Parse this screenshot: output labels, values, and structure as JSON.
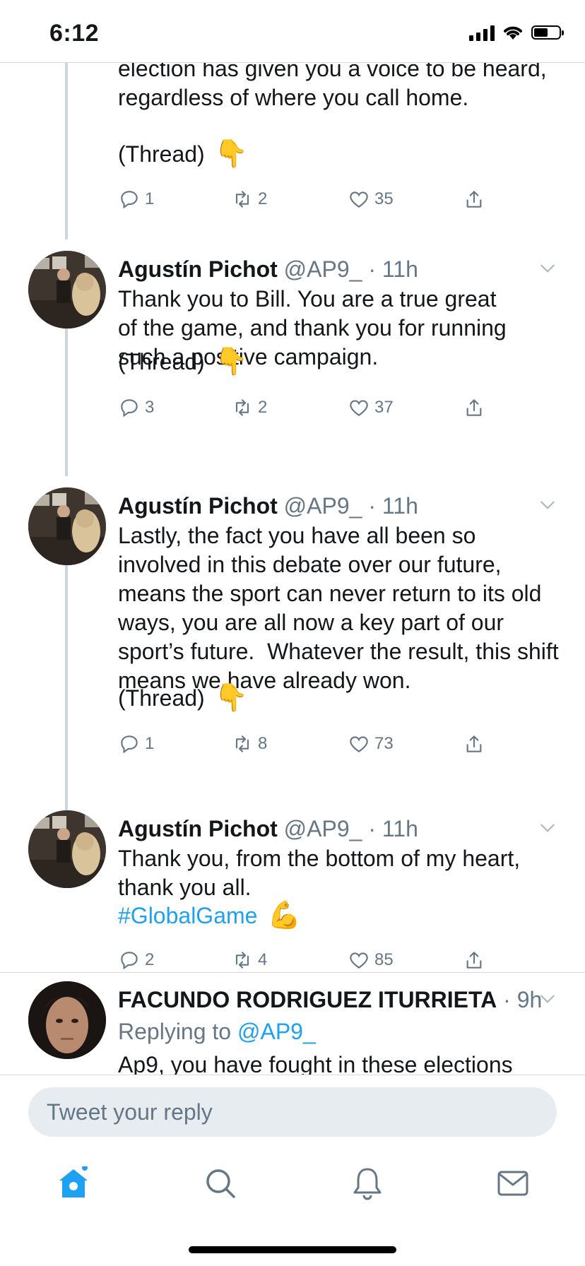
{
  "status_bar": {
    "time": "6:12",
    "battery_level": 0.55
  },
  "colors": {
    "accent": "#1da1f2",
    "secondary_text": "#657786",
    "thread_line": "#ccd6dd",
    "divider": "#d6d9dc"
  },
  "tweets": [
    {
      "text": "election has given you a voice to be heard,\nregardless of where you call home.",
      "thread_label": "(Thread)",
      "emoji": "👇",
      "replies": "1",
      "retweets": "2",
      "likes": "35"
    },
    {
      "name": "Agustín Pichot",
      "handle": "@AP9_",
      "time": "· 11h",
      "text": "Thank you to Bill. You are a true great of the game, and thank you for running such a positive campaign.",
      "thread_label": "(Thread)",
      "emoji": "👇",
      "replies": "3",
      "retweets": "2",
      "likes": "37"
    },
    {
      "name": "Agustín Pichot",
      "handle": "@AP9_",
      "time": "· 11h",
      "text": "Lastly, the fact you have all been so involved in this debate over our future, means the sport can never return to its old ways, you are all now a key part of our sport’s future.  Whatever the result, this shift means we have already won.",
      "thread_label": "(Thread)",
      "emoji": "👇",
      "replies": "1",
      "retweets": "8",
      "likes": "73"
    },
    {
      "name": "Agustín Pichot",
      "handle": "@AP9_",
      "time": "· 11h",
      "text": "Thank you, from the bottom of my heart, thank you all.",
      "hashtag": "#GlobalGame",
      "emoji": "💪",
      "replies": "2",
      "retweets": "4",
      "likes": "85"
    },
    {
      "name": "FACUNDO RODRIGUEZ ITURRIETA",
      "time": "· 9h",
      "reply_prefix": "Replying to",
      "reply_to": "@AP9_",
      "text": "Ap9, you have fought in these elections"
    }
  ],
  "composer": {
    "placeholder": "Tweet your reply"
  },
  "tabbar": {
    "items": [
      "home-icon",
      "search-icon",
      "notifications-icon",
      "messages-icon"
    ]
  }
}
